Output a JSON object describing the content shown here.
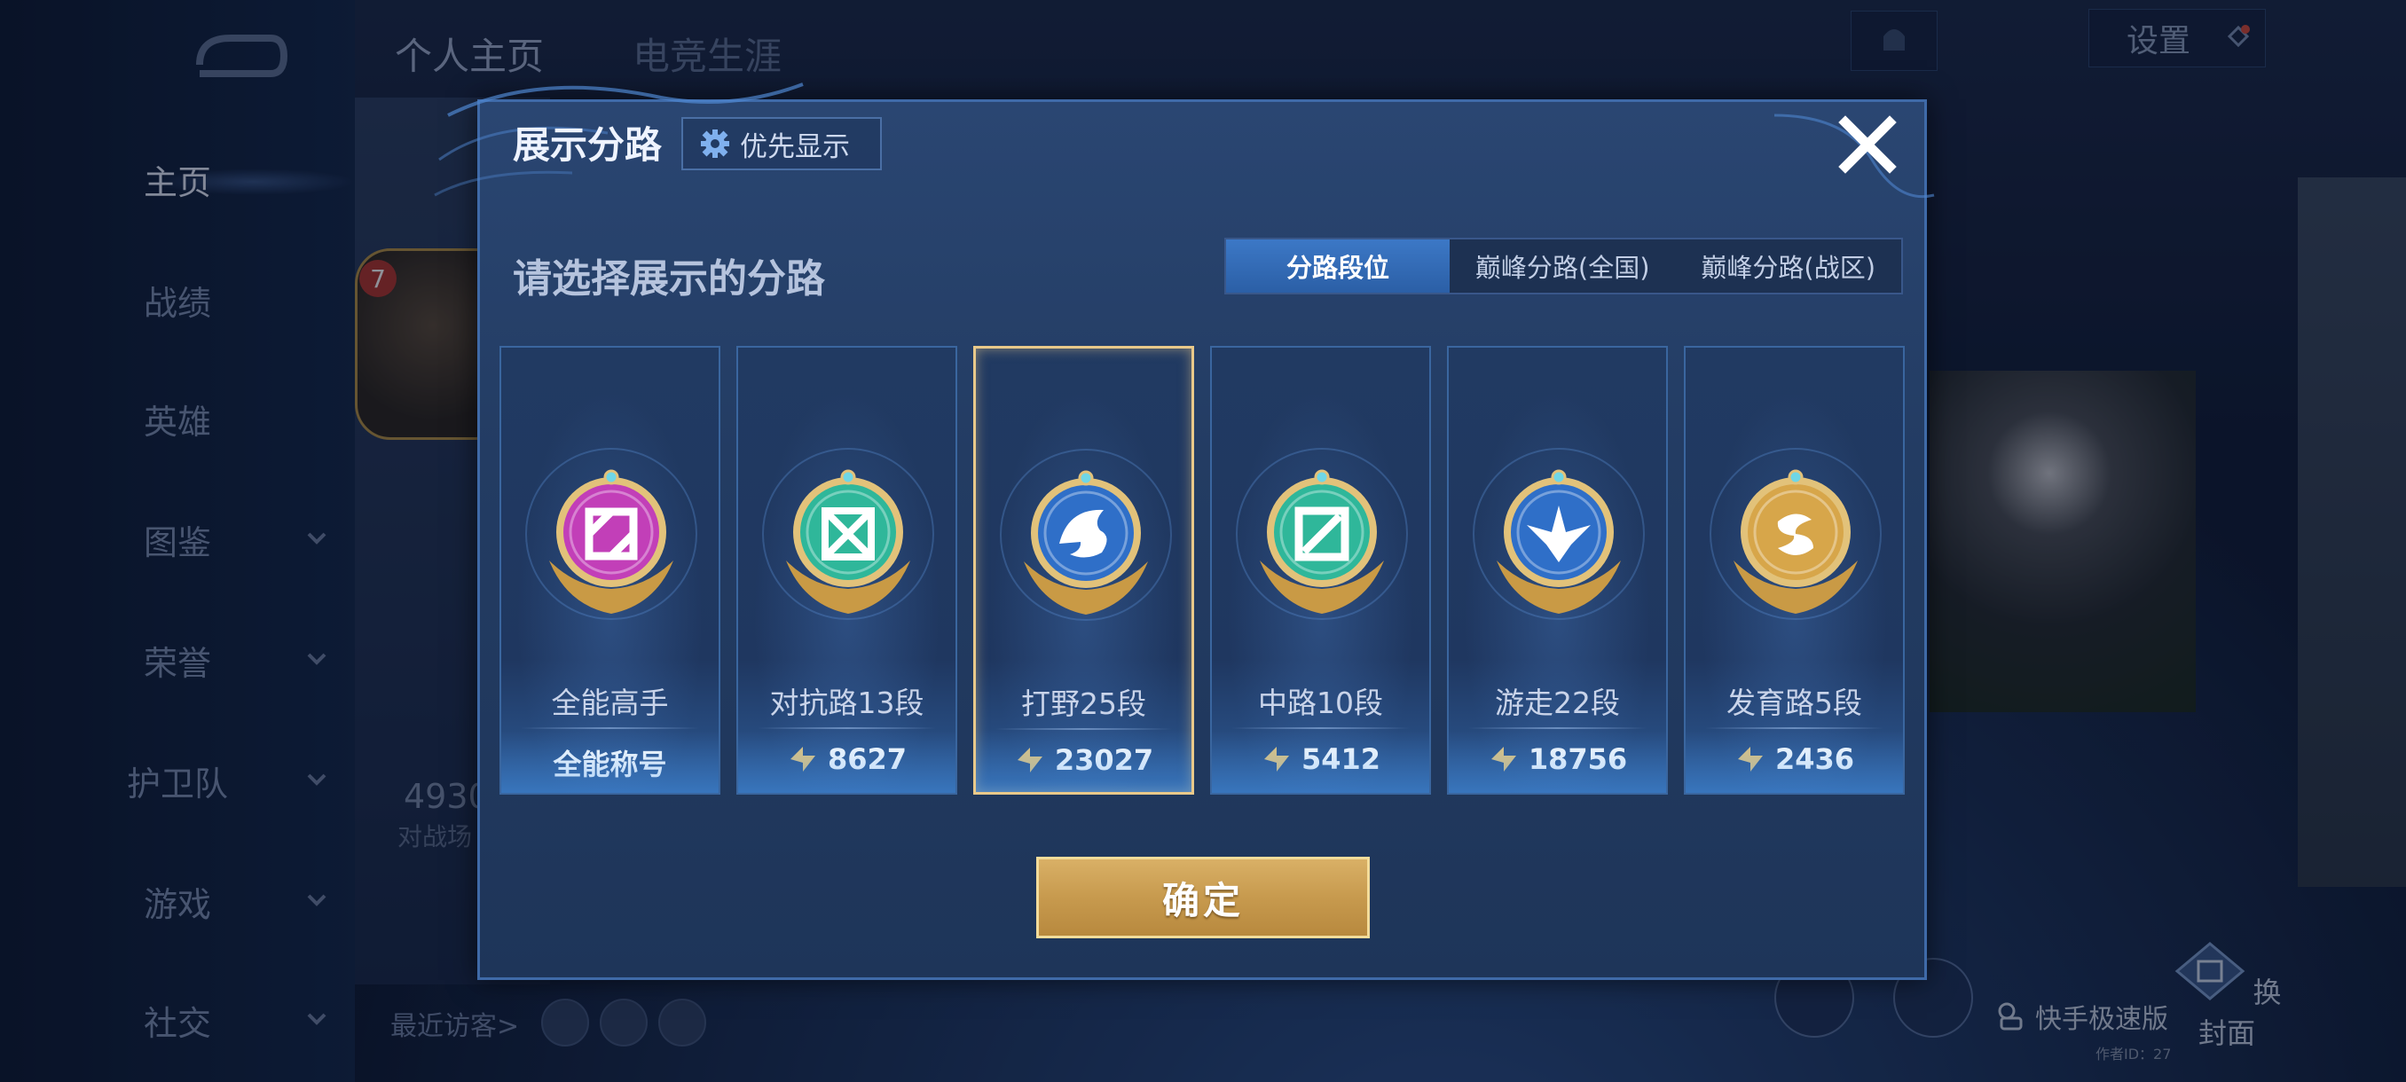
{
  "background": {
    "nav": {
      "items": [
        {
          "label": "主页",
          "active": true,
          "has_chevron": false
        },
        {
          "label": "战绩",
          "active": false,
          "has_chevron": false
        },
        {
          "label": "英雄",
          "active": false,
          "has_chevron": false
        },
        {
          "label": "图鉴",
          "active": false,
          "has_chevron": true
        },
        {
          "label": "荣誉",
          "active": false,
          "has_chevron": true
        },
        {
          "label": "护卫队",
          "active": false,
          "has_chevron": true
        },
        {
          "label": "游戏",
          "active": false,
          "has_chevron": true
        },
        {
          "label": "社交",
          "active": false,
          "has_chevron": true
        }
      ]
    },
    "top_tabs": [
      "个人主页",
      "电竞生涯"
    ],
    "settings_label": "设置",
    "avatar_level": "7",
    "stat_number": "4930",
    "stat_label": "对战场",
    "recent_visitors_label": "最近访客>",
    "kuaishou_label": "快手极速版",
    "kuaishou_sub": "作者ID：27",
    "change_cover_label": "换封面"
  },
  "modal": {
    "title": "展示分路",
    "priority_button": "优先显示",
    "subtitle": "请选择展示的分路",
    "segment_tabs": [
      {
        "label": "分路段位",
        "active": true
      },
      {
        "label": "巅峰分路(全国)",
        "active": false
      },
      {
        "label": "巅峰分路(战区)",
        "active": false
      }
    ],
    "cards": [
      {
        "label": "全能高手",
        "score": "全能称号",
        "score_icon": false,
        "badge_color": "#c23fb8",
        "badge_icon": "all-round-icon",
        "selected": false
      },
      {
        "label": "对抗路13段",
        "score": "8627",
        "score_icon": true,
        "badge_color": "#2fb79a",
        "badge_icon": "clash-lane-icon",
        "selected": false
      },
      {
        "label": "打野25段",
        "score": "23027",
        "score_icon": true,
        "badge_color": "#2f6fc8",
        "badge_icon": "jungle-icon",
        "selected": true
      },
      {
        "label": "中路10段",
        "score": "5412",
        "score_icon": true,
        "badge_color": "#2fb79a",
        "badge_icon": "mid-lane-icon",
        "selected": false
      },
      {
        "label": "游走22段",
        "score": "18756",
        "score_icon": true,
        "badge_color": "#2f6fc8",
        "badge_icon": "roam-icon",
        "selected": false
      },
      {
        "label": "发育路5段",
        "score": "2436",
        "score_icon": true,
        "badge_color": "#d7a64a",
        "badge_icon": "farm-lane-icon",
        "selected": false
      }
    ],
    "confirm_button": "确定",
    "colors": {
      "accent_blue": "#3c78c6",
      "gold": "#c79a4e",
      "selected_border": "#e9c98a"
    }
  }
}
